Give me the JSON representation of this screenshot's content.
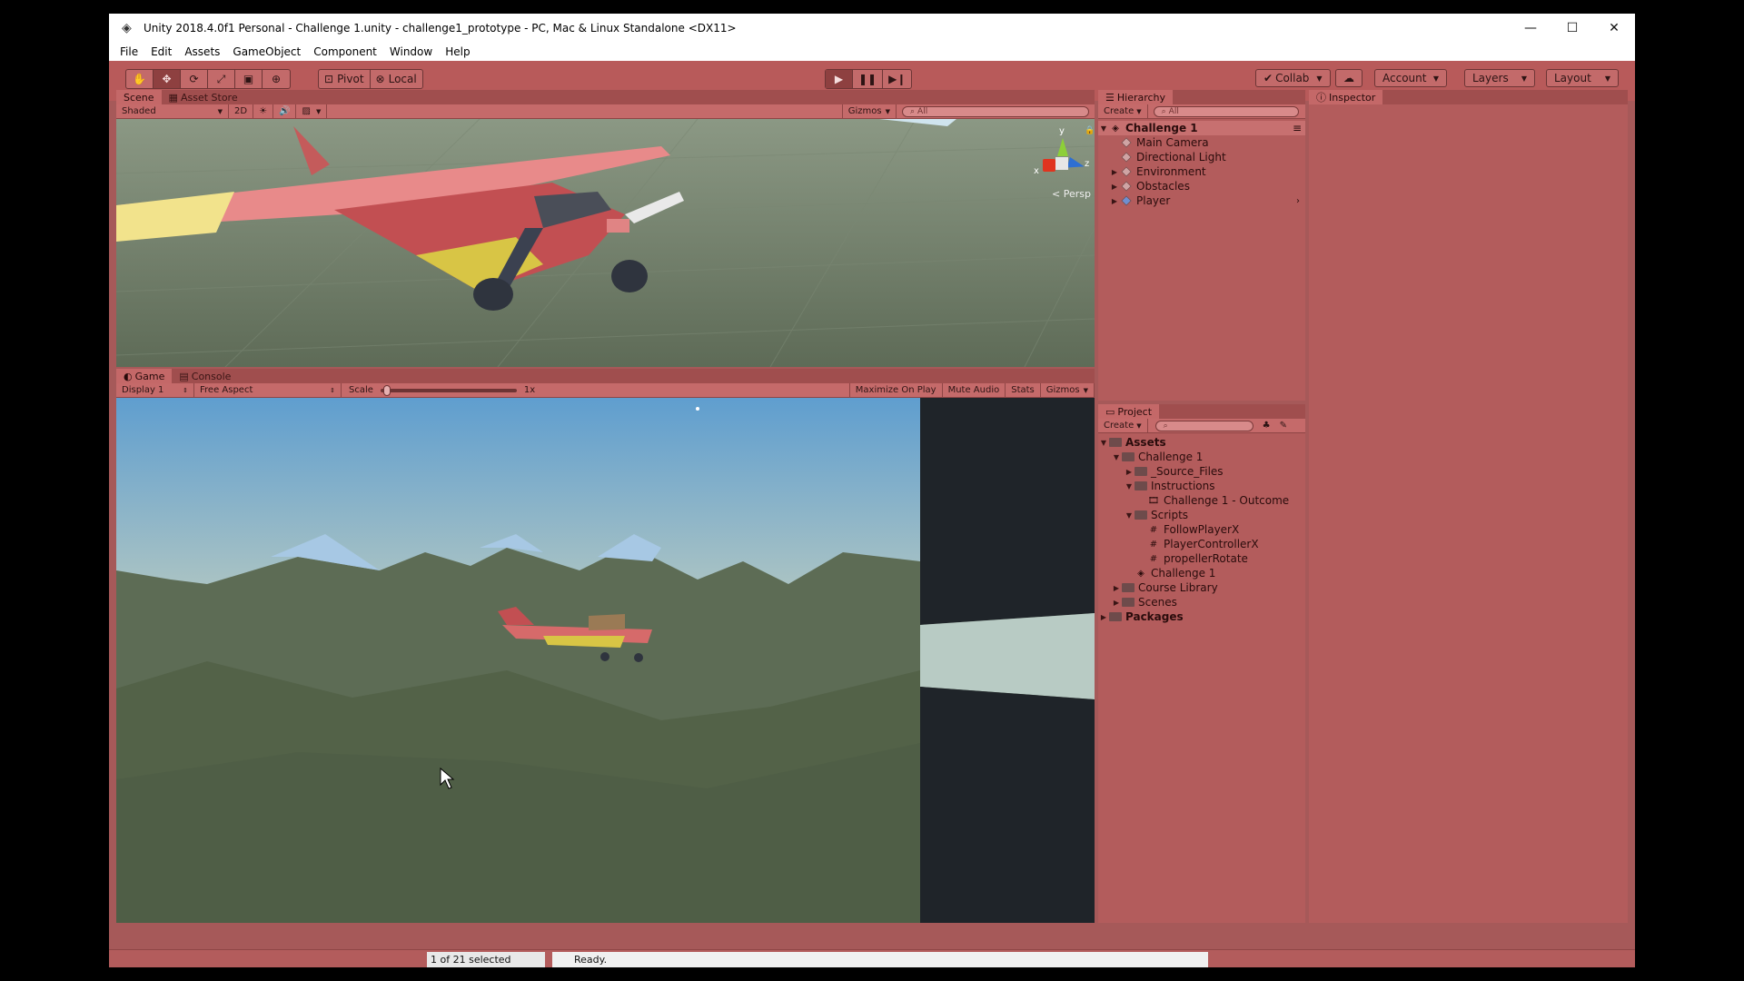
{
  "window": {
    "title": "Unity 2018.4.0f1 Personal - Challenge 1.unity - challenge1_prototype - PC, Mac & Linux Standalone <DX11>",
    "minimize": "—",
    "maximize": "☐",
    "close": "✕"
  },
  "menu": [
    "File",
    "Edit",
    "Assets",
    "GameObject",
    "Component",
    "Window",
    "Help"
  ],
  "toolbar": {
    "pivot": "Pivot",
    "local": "Local",
    "collab": "Collab",
    "account": "Account",
    "layers": "Layers",
    "layout": "Layout"
  },
  "scene_panel": {
    "tabs": [
      "Scene",
      "Asset Store"
    ],
    "shading": "Shaded",
    "mode_2d": "2D",
    "gizmos": "Gizmos",
    "search_placeholder": "All",
    "persp": "Persp",
    "axis_y": "y",
    "axis_x": "x",
    "axis_z": "z"
  },
  "game_panel": {
    "tabs": [
      "Game",
      "Console"
    ],
    "display": "Display 1",
    "aspect": "Free Aspect",
    "scale_label": "Scale",
    "scale_value": "1x",
    "scale_level": 0.02,
    "maximize_on_play": "Maximize On Play",
    "mute_audio": "Mute Audio",
    "stats": "Stats",
    "gizmos": "Gizmos"
  },
  "hierarchy": {
    "tab": "Hierarchy",
    "create": "Create",
    "search_placeholder": "All",
    "scene": "Challenge 1",
    "items": [
      "Main Camera",
      "Directional Light",
      "Environment",
      "Obstacles",
      "Player"
    ]
  },
  "inspector": {
    "tab": "Inspector"
  },
  "project": {
    "tab": "Project",
    "create": "Create",
    "tree": {
      "assets": "Assets",
      "challenge1": "Challenge 1",
      "source_files": "_Source_Files",
      "instructions": "Instructions",
      "outcome": "Challenge 1 - Outcome",
      "scripts": "Scripts",
      "script_items": [
        "FollowPlayerX",
        "PlayerControllerX",
        "propellerRotate"
      ],
      "scene": "Challenge 1",
      "course_library": "Course Library",
      "scenes": "Scenes",
      "packages": "Packages"
    }
  },
  "status": {
    "selection": "1 of 21 selected",
    "message": "Ready."
  },
  "colors": {
    "editor_tint": "#b35c5c",
    "sky_top": "#5f9ecf",
    "terrain": "#5c6b52"
  }
}
